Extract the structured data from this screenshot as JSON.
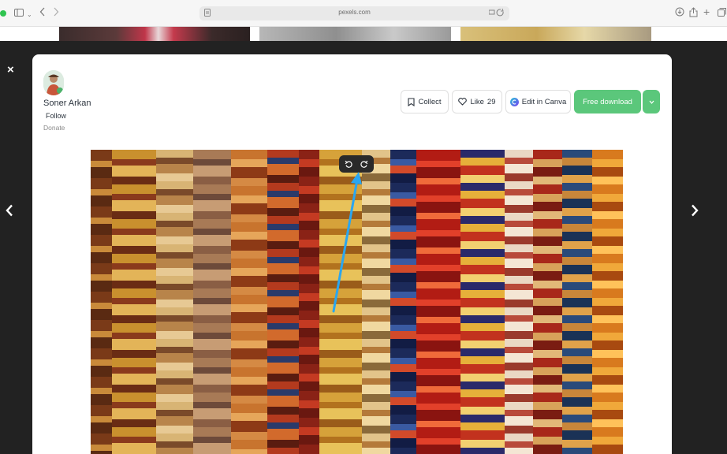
{
  "browser": {
    "url": "pexels.com"
  },
  "modal": {
    "author": {
      "name": "Soner Arkan",
      "follow_label": "Follow",
      "donate_label": "Donate"
    },
    "actions": {
      "collect_label": "Collect",
      "like_label": "Like",
      "like_count": "29",
      "canva_label": "Edit in Canva",
      "download_label": "Free download"
    }
  },
  "overlay": {
    "close_glyph": "×",
    "prev_glyph": "‹",
    "next_glyph": "›"
  },
  "colors": {
    "download_green": "#5bc77b",
    "annotation_arrow": "#2aa6f0",
    "overlay_dark": "#222222"
  }
}
